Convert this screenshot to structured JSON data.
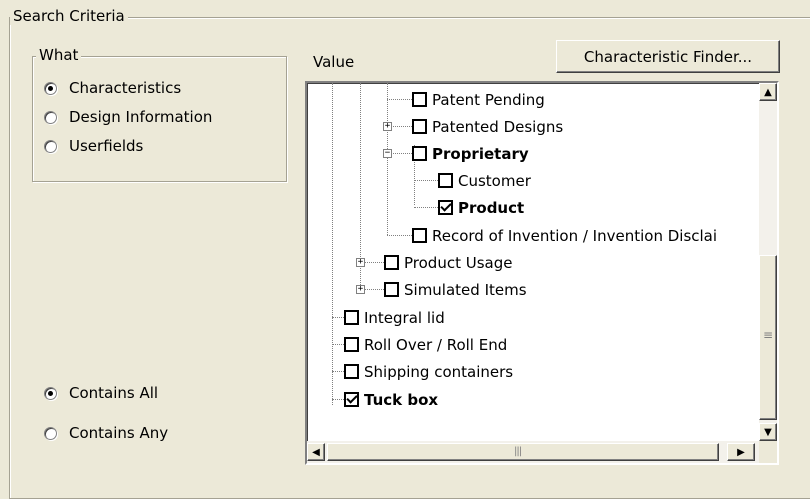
{
  "search_criteria": {
    "legend": "Search Criteria",
    "what_group": {
      "legend": "What",
      "options": [
        {
          "label": "Characteristics",
          "selected": true
        },
        {
          "label": "Design Information",
          "selected": false
        },
        {
          "label": "Userfields",
          "selected": false
        }
      ]
    },
    "match_options": [
      {
        "label": "Contains All",
        "selected": true
      },
      {
        "label": "Contains Any",
        "selected": false
      }
    ],
    "value_label": "Value",
    "finder_button": "Characteristic Finder...",
    "tree": [
      {
        "label": "Patent Pending",
        "checked": false,
        "bold": false,
        "expander": ""
      },
      {
        "label": "Patented Designs",
        "checked": false,
        "bold": false,
        "expander": "+"
      },
      {
        "label": "Proprietary",
        "checked": false,
        "bold": true,
        "expander": "−"
      },
      {
        "label": "Customer",
        "checked": false,
        "bold": false,
        "expander": ""
      },
      {
        "label": "Product",
        "checked": true,
        "bold": true,
        "expander": ""
      },
      {
        "label": "Record of Invention / Invention Disclai",
        "checked": false,
        "bold": false,
        "expander": ""
      },
      {
        "label": "Product Usage",
        "checked": false,
        "bold": false,
        "expander": "+"
      },
      {
        "label": "Simulated Items",
        "checked": false,
        "bold": false,
        "expander": "+"
      },
      {
        "label": "Integral lid",
        "checked": false,
        "bold": false,
        "expander": ""
      },
      {
        "label": "Roll Over / Roll End",
        "checked": false,
        "bold": false,
        "expander": ""
      },
      {
        "label": "Shipping containers",
        "checked": false,
        "bold": false,
        "expander": ""
      },
      {
        "label": "Tuck box",
        "checked": true,
        "bold": true,
        "expander": ""
      }
    ],
    "scrollbars": {
      "up_icon": "▲",
      "down_icon": "▼",
      "left_icon": "◀",
      "right_icon": "▶",
      "grip_icon": "≡",
      "hgrip_icon": "|||"
    }
  }
}
